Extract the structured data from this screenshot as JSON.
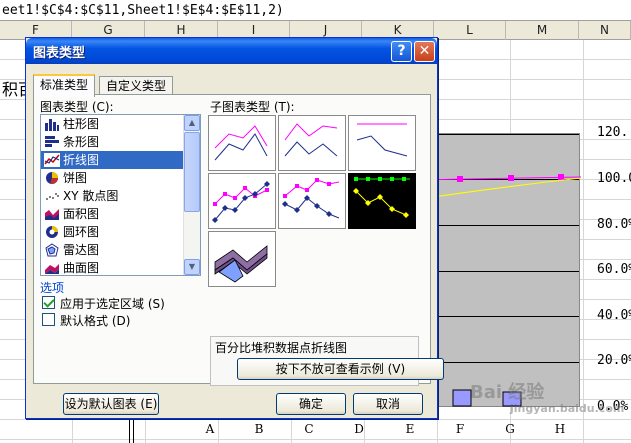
{
  "formula_bar": {
    "text": "eet1!$C$4:$C$11,Sheet1!$E$4:$E$11,2)"
  },
  "sheet": {
    "col_headers": [
      "F",
      "G",
      "H",
      "I",
      "J",
      "K",
      "L",
      "M",
      "N"
    ],
    "partial_cell_text": "积百",
    "y_axis_labels": [
      "120.",
      "100.0",
      "80.0%",
      "60.0%",
      "40.0%",
      "20.0%",
      "0.0%"
    ],
    "x_axis_labels": [
      "A",
      "B",
      "C",
      "D",
      "E",
      "F",
      "G",
      "H"
    ],
    "watermark": "Bai 经验",
    "watermark_sub": "jingyan.baidu.com",
    "series_color": "#ff00ff",
    "line2_color": "#ffff00",
    "plot_color": "#c0c0c0"
  },
  "dialog": {
    "title": "图表类型",
    "help_label": "?",
    "close_label": "✕",
    "tabs": [
      {
        "label": "标准类型",
        "active": true
      },
      {
        "label": "自定义类型",
        "active": false
      }
    ],
    "chart_type_label": "图表类型 (C):",
    "subtype_label": "子图表类型 (T):",
    "chart_types": [
      {
        "label": "柱形图",
        "icon": "column-chart-icon"
      },
      {
        "label": "条形图",
        "icon": "bar-chart-icon"
      },
      {
        "label": "折线图",
        "icon": "line-chart-icon",
        "selected": true
      },
      {
        "label": "饼图",
        "icon": "pie-chart-icon"
      },
      {
        "label": "XY 散点图",
        "icon": "scatter-chart-icon"
      },
      {
        "label": "面积图",
        "icon": "area-chart-icon"
      },
      {
        "label": "圆环图",
        "icon": "doughnut-chart-icon"
      },
      {
        "label": "雷达图",
        "icon": "radar-chart-icon"
      },
      {
        "label": "曲面图",
        "icon": "surface-chart-icon"
      }
    ],
    "options_title": "选项",
    "option_apply": {
      "label": "应用于选定区域 (S)",
      "checked": true
    },
    "option_default": {
      "label": "默认格式 (D)",
      "checked": false
    },
    "description": "百分比堆积数据点折线图",
    "preview_button": "按下不放可查看示例 (V)",
    "set_default_button": "设为默认图表 (E)",
    "ok_button": "确定",
    "cancel_button": "取消"
  }
}
